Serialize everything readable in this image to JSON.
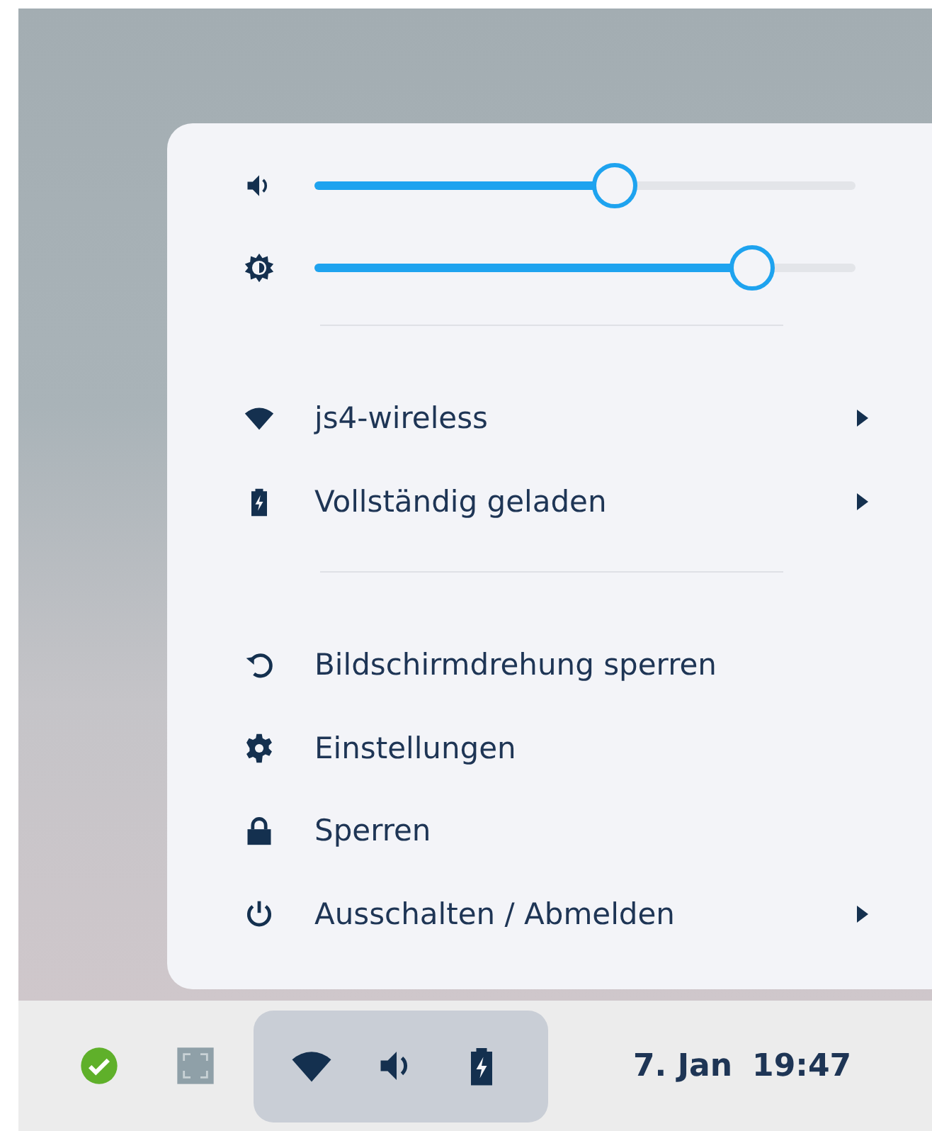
{
  "sliders": [
    {
      "kind": "volume",
      "level": 0.555
    },
    {
      "kind": "brightness",
      "level": 0.81
    }
  ],
  "sections": [
    {
      "items": [
        {
          "kind": "wifi",
          "label": "js4-wireless",
          "submenu": true
        },
        {
          "kind": "battery",
          "label": "Vollständig geladen",
          "submenu": true
        }
      ]
    },
    {
      "items": [
        {
          "kind": "rotation",
          "label": "Bildschirmdrehung sperren",
          "submenu": false
        },
        {
          "kind": "settings",
          "label": "Einstellungen",
          "submenu": false
        },
        {
          "kind": "lock",
          "label": "Sperren",
          "submenu": false
        },
        {
          "kind": "power",
          "label": "Ausschalten / Abmelden",
          "submenu": true
        }
      ]
    }
  ],
  "taskbar": {
    "indicators": [
      {
        "kind": "check"
      },
      {
        "kind": "screenshot"
      }
    ],
    "tray": [
      {
        "kind": "wifi"
      },
      {
        "kind": "volume"
      },
      {
        "kind": "battery"
      }
    ],
    "date": "7. Jan",
    "time": "19:47"
  }
}
